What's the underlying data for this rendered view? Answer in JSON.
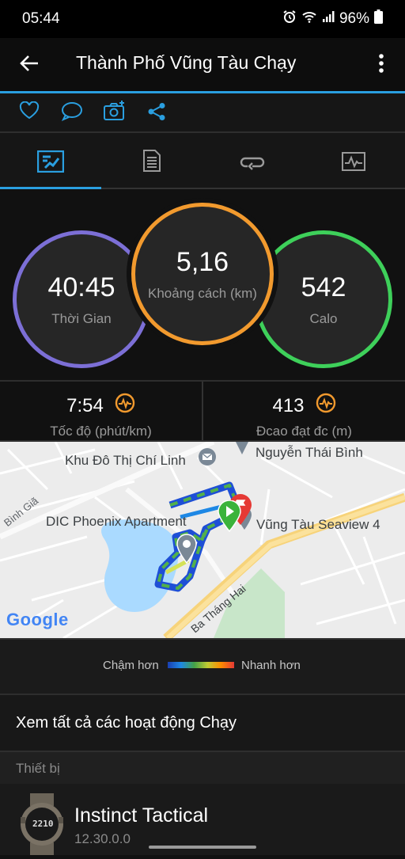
{
  "status_bar": {
    "time": "05:44",
    "battery": "96%"
  },
  "app_bar": {
    "title": "Thành Phố Vũng Tàu Chạy"
  },
  "stats": {
    "time": {
      "value": "40:45",
      "label": "Thời Gian"
    },
    "distance": {
      "value": "5,16",
      "label": "Khoảng cách (km)"
    },
    "calories": {
      "value": "542",
      "label": "Calo"
    }
  },
  "metrics": {
    "pace": {
      "value": "7:54",
      "label": "Tốc độ (phút/km)"
    },
    "elevation": {
      "value": "413",
      "label": "Đcao đạt đc (m)"
    }
  },
  "map": {
    "labels": {
      "chi_linh": "Khu Đô Thị Chí Linh",
      "nguyen_thai_binh": "Nguyễn Thái Bình",
      "dic_phoenix": "DIC Phoenix Apartment",
      "seaview": "Vũng Tàu Seaview 4",
      "binh_gia": "Bình Giã",
      "ba_thang_hai": "Ba Tháng Hai",
      "google": "Google"
    }
  },
  "legend": {
    "slower": "Chậm hơn",
    "faster": "Nhanh hơn"
  },
  "view_all_label": "Xem tất cả các hoạt động Chạy",
  "devices_header": "Thiết bị",
  "device": {
    "name": "Instinct Tactical",
    "version": "12.30.0.0",
    "watch_face_time": "2210"
  },
  "colors": {
    "accent": "#2a9fe0",
    "time_ring": "#7c6fd6",
    "distance_ring": "#f29a2e",
    "calorie_ring": "#3ed05a"
  }
}
